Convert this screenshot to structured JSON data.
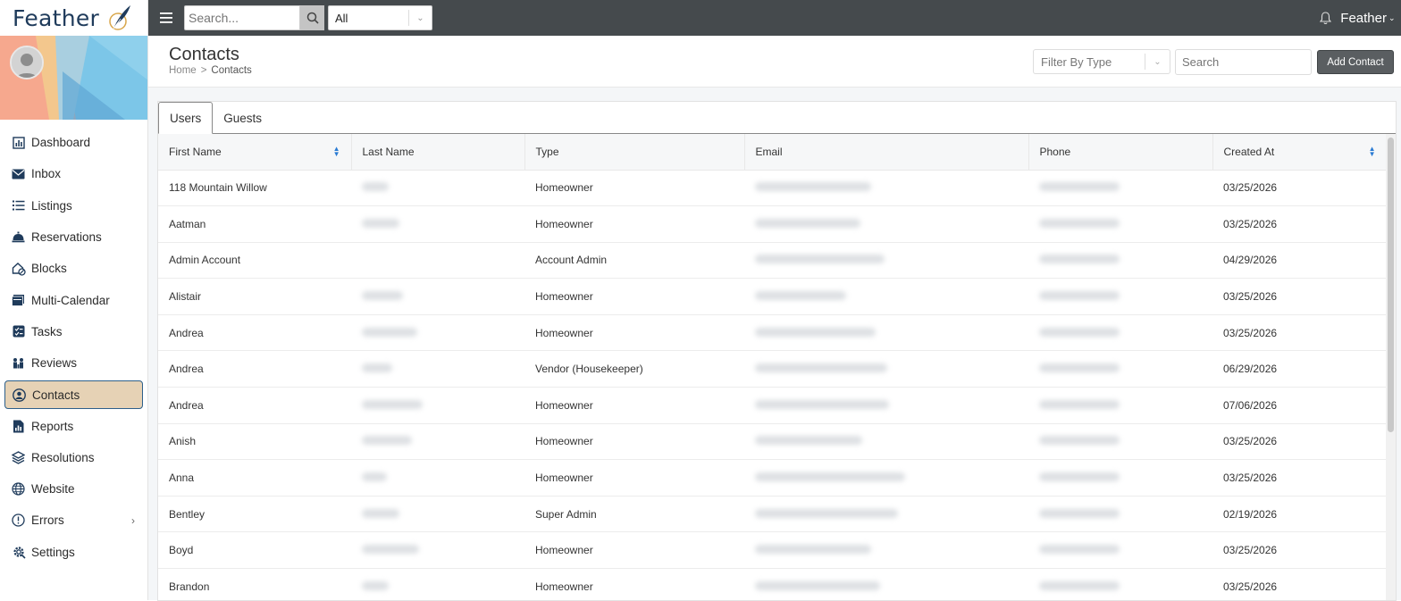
{
  "app": {
    "brand": "Feather"
  },
  "top": {
    "search_placeholder": "Search...",
    "filter_value": "All",
    "user_name": "Feather"
  },
  "nav": [
    {
      "label": "Dashboard",
      "icon": "chart-bar-icon"
    },
    {
      "label": "Inbox",
      "icon": "envelope-icon"
    },
    {
      "label": "Listings",
      "icon": "list-icon"
    },
    {
      "label": "Reservations",
      "icon": "bell-concierge-icon"
    },
    {
      "label": "Blocks",
      "icon": "house-block-icon"
    },
    {
      "label": "Multi-Calendar",
      "icon": "calendar-icon"
    },
    {
      "label": "Tasks",
      "icon": "tasks-icon"
    },
    {
      "label": "Reviews",
      "icon": "reviews-icon"
    },
    {
      "label": "Contacts",
      "icon": "contact-icon",
      "active": true
    },
    {
      "label": "Reports",
      "icon": "report-icon"
    },
    {
      "label": "Resolutions",
      "icon": "layers-icon"
    },
    {
      "label": "Website",
      "icon": "globe-icon"
    },
    {
      "label": "Errors",
      "icon": "alert-circle-icon",
      "has_submenu": true
    },
    {
      "label": "Settings",
      "icon": "gear-icon"
    }
  ],
  "page": {
    "title": "Contacts",
    "breadcrumb_home": "Home",
    "breadcrumb_sep": ">",
    "breadcrumb_current": "Contacts",
    "filter_type_placeholder": "Filter By Type",
    "search_placeholder": "Search",
    "add_button": "Add Contact"
  },
  "tabs": [
    "Users",
    "Guests"
  ],
  "table": {
    "columns": [
      "First Name",
      "Last Name",
      "Type",
      "Email",
      "Phone",
      "Created At"
    ],
    "rows": [
      {
        "first": "118 Mountain Willow",
        "type": "Homeowner",
        "created": "03/25/2026"
      },
      {
        "first": "Aatman",
        "type": "Homeowner",
        "created": "03/25/2026"
      },
      {
        "first": "Admin Account",
        "type": "Account Admin",
        "created": "04/29/2026"
      },
      {
        "first": "Alistair",
        "type": "Homeowner",
        "created": "03/25/2026"
      },
      {
        "first": "Andrea",
        "type": "Homeowner",
        "created": "03/25/2026"
      },
      {
        "first": "Andrea",
        "type": "Vendor (Housekeeper)",
        "created": "06/29/2026"
      },
      {
        "first": "Andrea",
        "type": "Homeowner",
        "created": "07/06/2026"
      },
      {
        "first": "Anish",
        "type": "Homeowner",
        "created": "03/25/2026"
      },
      {
        "first": "Anna",
        "type": "Homeowner",
        "created": "03/25/2026"
      },
      {
        "first": "Bentley",
        "type": "Super Admin",
        "created": "02/19/2026"
      },
      {
        "first": "Boyd",
        "type": "Homeowner",
        "created": "03/25/2026"
      },
      {
        "first": "Brandon",
        "type": "Homeowner",
        "created": "03/25/2026"
      }
    ]
  },
  "colors": {
    "topbar": "#454a4d",
    "active_nav_bg": "#e6d2b5",
    "active_nav_border": "#2d5f8a",
    "brand": "#1f3b5b"
  }
}
